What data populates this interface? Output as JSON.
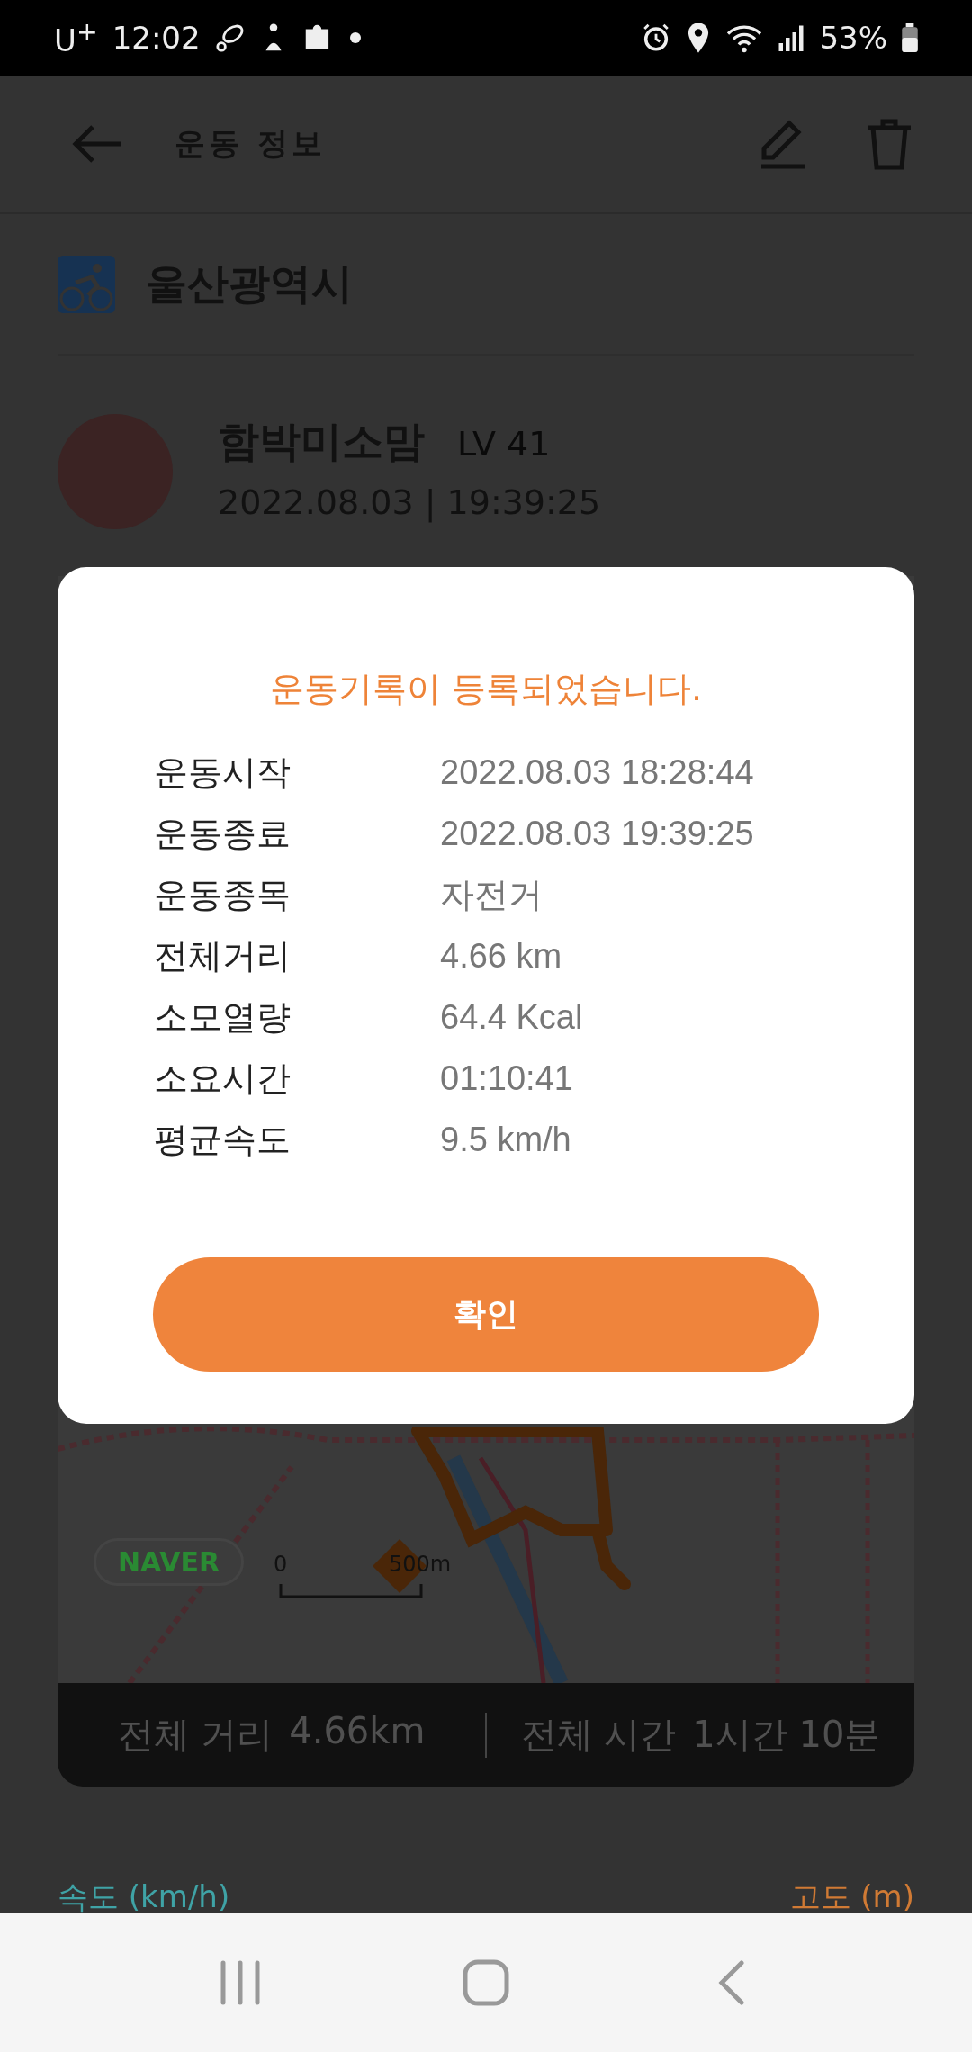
{
  "status_bar": {
    "carrier": "U$^{+}$",
    "time": "12:02",
    "battery": "53%"
  },
  "header": {
    "title": "운동 정보"
  },
  "location": {
    "name": "울산광역시"
  },
  "profile": {
    "name": "함박미소맘",
    "level": "LV 41",
    "datetime": "2022.08.03 | 19:39:25"
  },
  "map": {
    "logo": "NAVER",
    "scale_start": "0",
    "scale_end": "500m"
  },
  "summary": [
    {
      "label": "전체 거리",
      "value": "4.66km"
    },
    {
      "label": "전체 시간",
      "value": "1시간 10분"
    }
  ],
  "chart_labels": {
    "left": "속도 (km/h)",
    "right": "고도 (m)"
  },
  "dialog": {
    "title": "운동기록이 등록되었습니다.",
    "rows": [
      {
        "label": "운동시작",
        "value": "2022.08.03 18:28:44"
      },
      {
        "label": "운동종료",
        "value": "2022.08.03 19:39:25"
      },
      {
        "label": "운동종목",
        "value": "자전거"
      },
      {
        "label": "전체거리",
        "value": "4.66 km"
      },
      {
        "label": "소모열량",
        "value": "64.4 Kcal"
      },
      {
        "label": "소요시간",
        "value": "01:10:41"
      },
      {
        "label": "평균속도",
        "value": "9.5 km/h"
      }
    ],
    "confirm": "확인"
  }
}
